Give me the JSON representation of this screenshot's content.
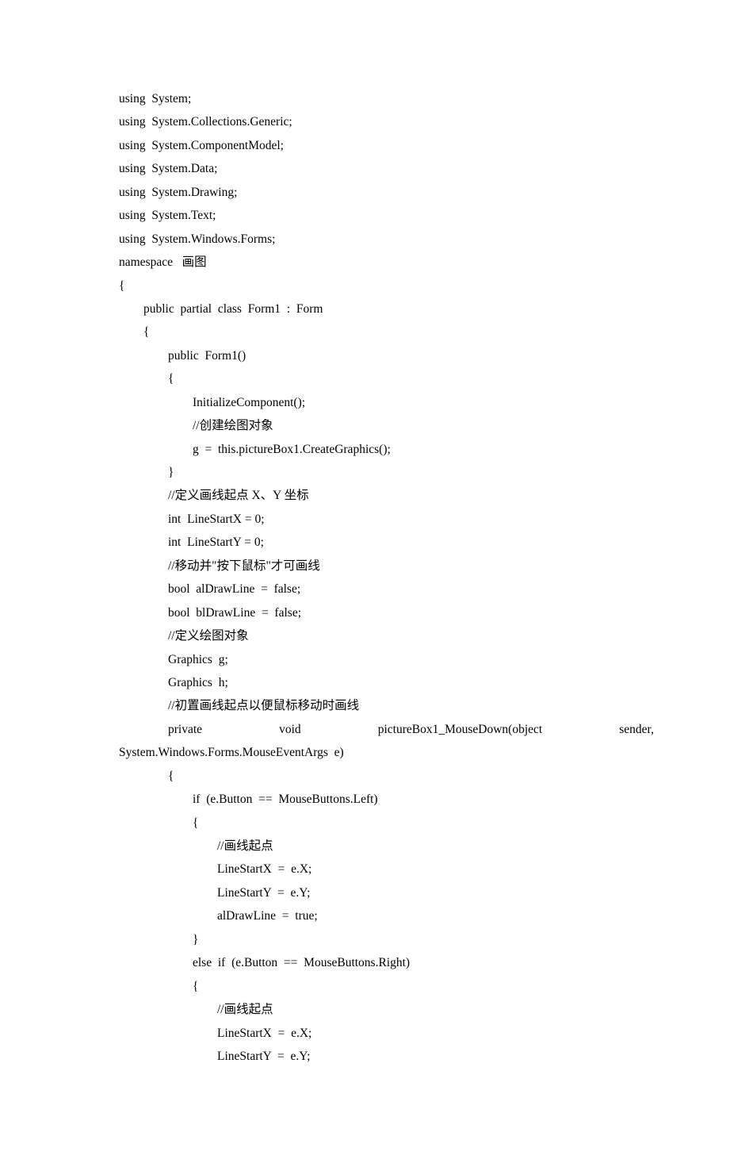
{
  "lines": [
    "using  System;",
    "using  System.Collections.Generic;",
    "using  System.ComponentModel;",
    "using  System.Data;",
    "using  System.Drawing;",
    "using  System.Text;",
    "using  System.Windows.Forms;",
    "",
    "namespace   画图",
    "{",
    "        public  partial  class  Form1  :  Form",
    "        {",
    "                public  Form1()",
    "                {",
    "                        InitializeComponent();",
    "                        //创建绘图对象",
    "                        g  =  this.pictureBox1.CreateGraphics();",
    "",
    "                }",
    "                //定义画线起点 X、Y 坐标",
    "                int  LineStartX = 0;",
    "                int  LineStartY = 0;",
    "                //移动并\"按下鼠标\"才可画线",
    "                bool  alDrawLine  =  false;",
    "                bool  blDrawLine  =  false;",
    "                //定义绘图对象",
    "                Graphics  g;",
    "                Graphics  h;",
    "                //初置画线起点以便鼠标移动时画线"
  ],
  "justifiedLine": {
    "parts": [
      "                private",
      "void",
      "pictureBox1_MouseDown(object",
      "sender,"
    ]
  },
  "linesAfter": [
    "System.Windows.Forms.MouseEventArgs  e)",
    "                {",
    "                        if  (e.Button  ==  MouseButtons.Left)",
    "                        {",
    "                                //画线起点",
    "                                LineStartX  =  e.X;",
    "                                LineStartY  =  e.Y;",
    "                                alDrawLine  =  true;",
    "                        }",
    "                        else  if  (e.Button  ==  MouseButtons.Right)",
    "                        {",
    "                                //画线起点",
    "                                LineStartX  =  e.X;",
    "                                LineStartY  =  e.Y;"
  ]
}
